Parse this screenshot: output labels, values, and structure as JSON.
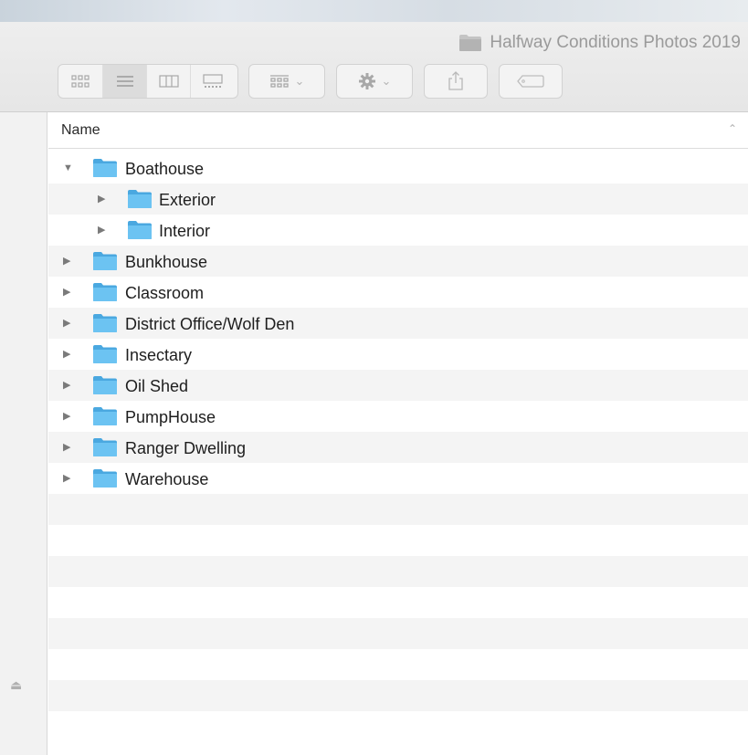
{
  "window": {
    "title": "Halfway Conditions Photos 2019"
  },
  "toolbar": {
    "view_buttons": [
      {
        "name": "icon-view",
        "selected": false
      },
      {
        "name": "list-view",
        "selected": true
      },
      {
        "name": "column-view",
        "selected": false
      },
      {
        "name": "gallery-view",
        "selected": false
      }
    ],
    "group_button": "group-icon",
    "action_button": "gear-icon",
    "share_button": "share-icon",
    "tags_button": "tag-icon"
  },
  "list": {
    "column_header": "Name",
    "items": [
      {
        "label": "Boathouse",
        "level": 0,
        "expanded": true
      },
      {
        "label": "Exterior",
        "level": 1,
        "expanded": false
      },
      {
        "label": "Interior",
        "level": 1,
        "expanded": false
      },
      {
        "label": "Bunkhouse",
        "level": 0,
        "expanded": false
      },
      {
        "label": "Classroom",
        "level": 0,
        "expanded": false
      },
      {
        "label": "District Office/Wolf Den",
        "level": 0,
        "expanded": false
      },
      {
        "label": "Insectary",
        "level": 0,
        "expanded": false
      },
      {
        "label": "Oil Shed",
        "level": 0,
        "expanded": false
      },
      {
        "label": "PumpHouse",
        "level": 0,
        "expanded": false
      },
      {
        "label": "Ranger Dwelling",
        "level": 0,
        "expanded": false
      },
      {
        "label": "Warehouse",
        "level": 0,
        "expanded": false
      }
    ]
  },
  "colors": {
    "folder_blue": "#6cc3f2",
    "folder_blue_dark": "#4aa8e0",
    "toolbar_bg": "#ececec",
    "stripe": "#f4f4f4"
  }
}
